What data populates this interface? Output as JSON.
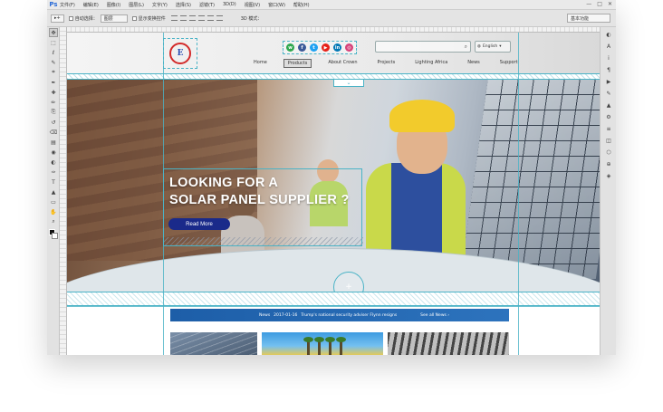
{
  "app": {
    "logo_label": "Ps",
    "menu": [
      "文件(F)",
      "编辑(E)",
      "图像(I)",
      "图层(L)",
      "文字(Y)",
      "选择(S)",
      "滤镜(T)",
      "3D(D)",
      "视图(V)",
      "窗口(W)",
      "帮助(H)"
    ],
    "window_controls": [
      "—",
      "□",
      "✕"
    ]
  },
  "options_bar": {
    "tool_glyph": "▸+",
    "auto_select_label": "自动选择：",
    "auto_select_value": "图层",
    "show_transform_label": "显示变换控件",
    "mode3d_label": "3D 模式：",
    "workspace": "基本功能"
  },
  "toolbar_left": [
    "move-tool",
    "marquee-tool",
    "lasso-tool",
    "quick-select-tool",
    "crop-tool",
    "eyedropper-tool",
    "healing-brush-tool",
    "brush-tool",
    "clone-stamp-tool",
    "history-brush-tool",
    "eraser-tool",
    "gradient-tool",
    "blur-tool",
    "dodge-tool",
    "pen-tool",
    "type-tool",
    "path-select-tool",
    "shape-tool",
    "hand-tool",
    "zoom-tool"
  ],
  "toolbar_glyphs": [
    "✥",
    "⬚",
    "ℓ",
    "✎",
    "⌗",
    "✒",
    "✚",
    "✏",
    "⎘",
    "↺",
    "⌫",
    "▤",
    "◉",
    "◐",
    "✑",
    "T",
    "▲",
    "▭",
    "✋",
    "⌕"
  ],
  "right_panel": [
    "◐",
    "A",
    "i",
    "¶",
    "▶",
    "✎",
    "▲",
    "⚙",
    "≡",
    "◫",
    "⬡",
    "⊕",
    "◈"
  ],
  "site": {
    "nav": [
      "Home",
      "Products",
      "About Crown",
      "Projects",
      "Lighting Africa",
      "News",
      "Support"
    ],
    "nav_selected_index": 1,
    "language": "English",
    "social": [
      {
        "name": "wechat",
        "color": "#2fa84f",
        "glyph": "w"
      },
      {
        "name": "facebook",
        "color": "#3b5998",
        "glyph": "f"
      },
      {
        "name": "twitter",
        "color": "#1da1f2",
        "glyph": "t"
      },
      {
        "name": "youtube",
        "color": "#e62117",
        "glyph": "▶"
      },
      {
        "name": "linkedin",
        "color": "#0077b5",
        "glyph": "in"
      },
      {
        "name": "instagram",
        "color": "#d6437a",
        "glyph": "◎"
      }
    ],
    "hero": {
      "title_line1": "LOOKING FOR A",
      "title_line2": "SOLAR PANEL SUPPLIER ?",
      "button": "Read More"
    },
    "news": {
      "label": "News",
      "date": "2017-01-16",
      "headline": "Trump's national security adviser Flynn resigns",
      "see_all": "See all News  ›"
    }
  },
  "colors": {
    "accent_guide": "#4ab3c6",
    "button_navy": "#1a2a8a",
    "news_bar": "#1d5ea8",
    "hardhat": "#f2cb2c"
  }
}
